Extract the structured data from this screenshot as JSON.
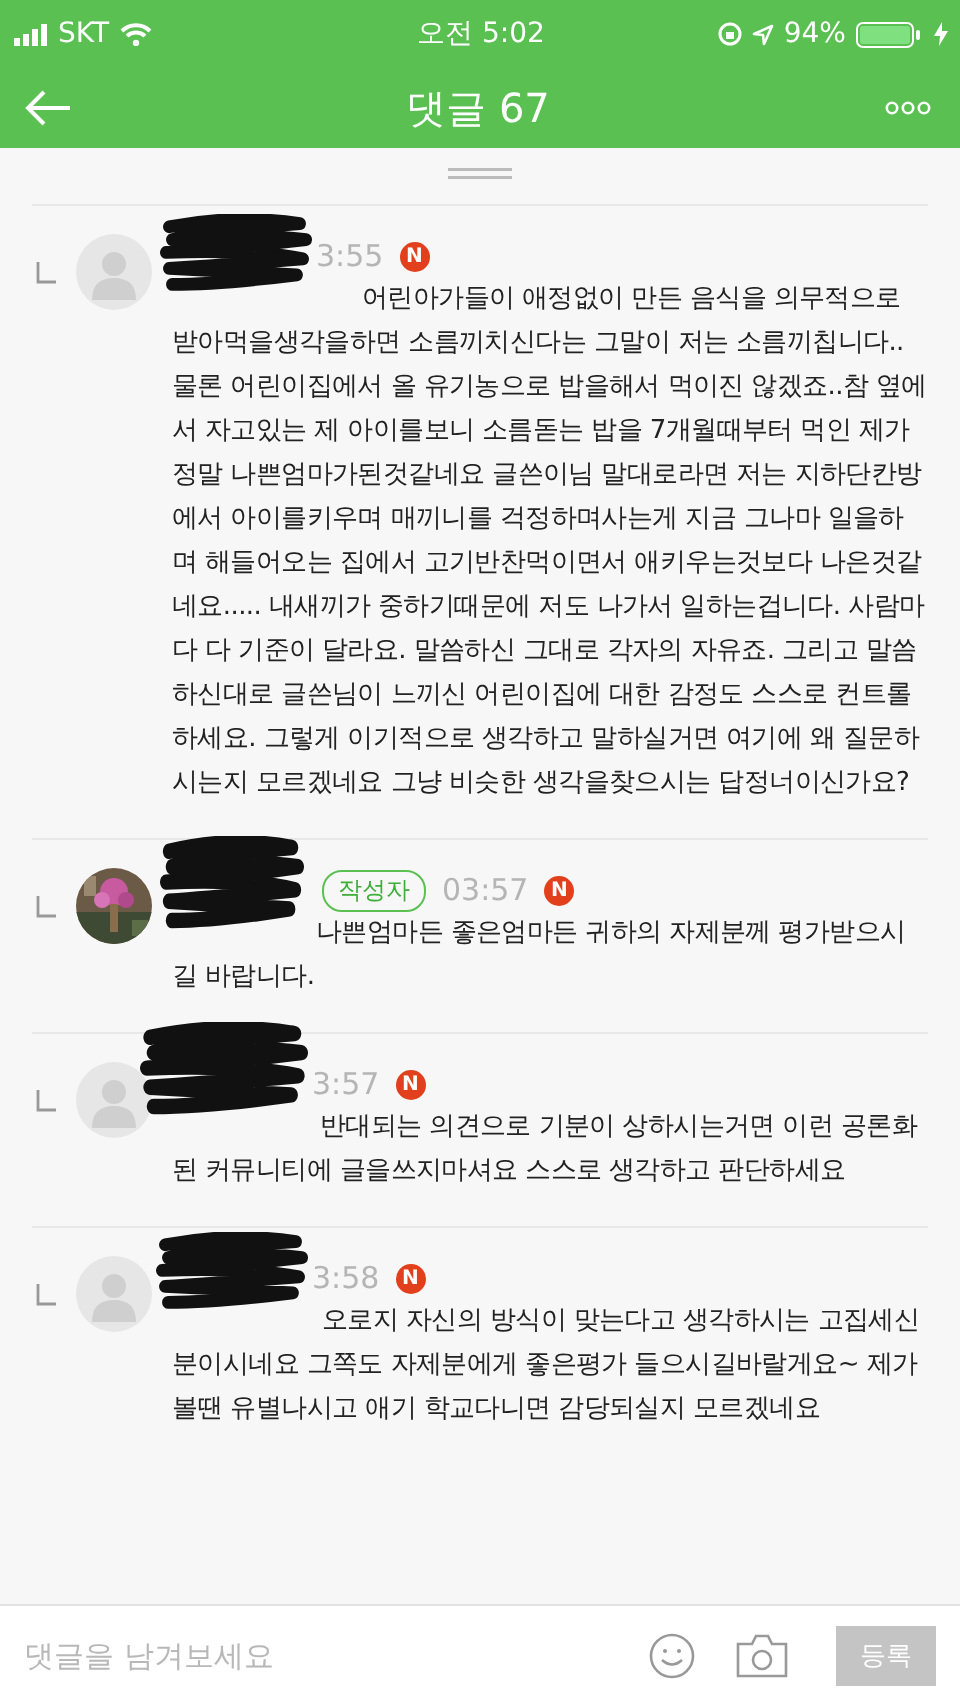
{
  "status_bar": {
    "carrier": "SKT",
    "time": "오전 5:02",
    "battery": "94%"
  },
  "header": {
    "title": "댓글 67"
  },
  "comments": [
    {
      "avatar": {
        "kind": "default"
      },
      "time": "3:55",
      "new_badge": "N",
      "text": "어린아가들이 애정없이 만든 음식을 의무적으로 받아먹을생각을하면 소름끼치신다는 그말이 저는 소름끼칩니다.. 물론 어린이집에서 올 유기농으로 밥을해서 먹이진 않겠죠..참 옆에서 자고있는 제 아이를보니 소름돋는 밥을 7개월때부터 먹인 제가 정말 나쁜엄마가된것같네요 글쓴이님 말대로라면 저는 지하단칸방에서 아이를키우며 매끼니를 걱정하며사는게 지금 그나마 일을하며 해들어오는 집에서 고기반찬먹이면서 애키우는것보다 나은것같네요..... 내새끼가 중하기때문에 저도 나가서 일하는겁니다. 사람마다 다 기준이 달라요. 말씀하신 그대로 각자의 자유죠. 그리고 말씀하신대로 글쓴님이 느끼신 어린이집에 대한 감정도 스스로 컨트롤하세요. 그렇게 이기적으로 생각하고 말하실거면 여기에 왜 질문하시는지 모르겠네요 그냥 비슷한 생각을찾으시는 답정너이신가요?"
    },
    {
      "author_badge": "작성자",
      "time": "03:57",
      "new_badge": "N",
      "text": "나쁜엄마든 좋은엄마든 귀하의 자제분께 평가받으시길 바랍니다."
    },
    {
      "avatar": {
        "kind": "default"
      },
      "time": "3:57",
      "new_badge": "N",
      "text": "반대되는 의견으로 기분이 상하시는거면 이런 공론화된 커뮤니티에 글을쓰지마셔요 스스로 생각하고 판단하세요"
    },
    {
      "avatar": {
        "kind": "default"
      },
      "time": "3:58",
      "new_badge": "N",
      "text": "오로지 자신의 방식이 맞는다고 생각하시는 고집세신분이시네요 그쪽도 자제분에게 좋은평가 들으시길바랄게요~ 제가볼땐 유별나시고 애기 학교다니면 감당되실지 모르겠네요"
    }
  ],
  "composer": {
    "placeholder": "댓글을 남겨보세요",
    "submit": "등록"
  }
}
